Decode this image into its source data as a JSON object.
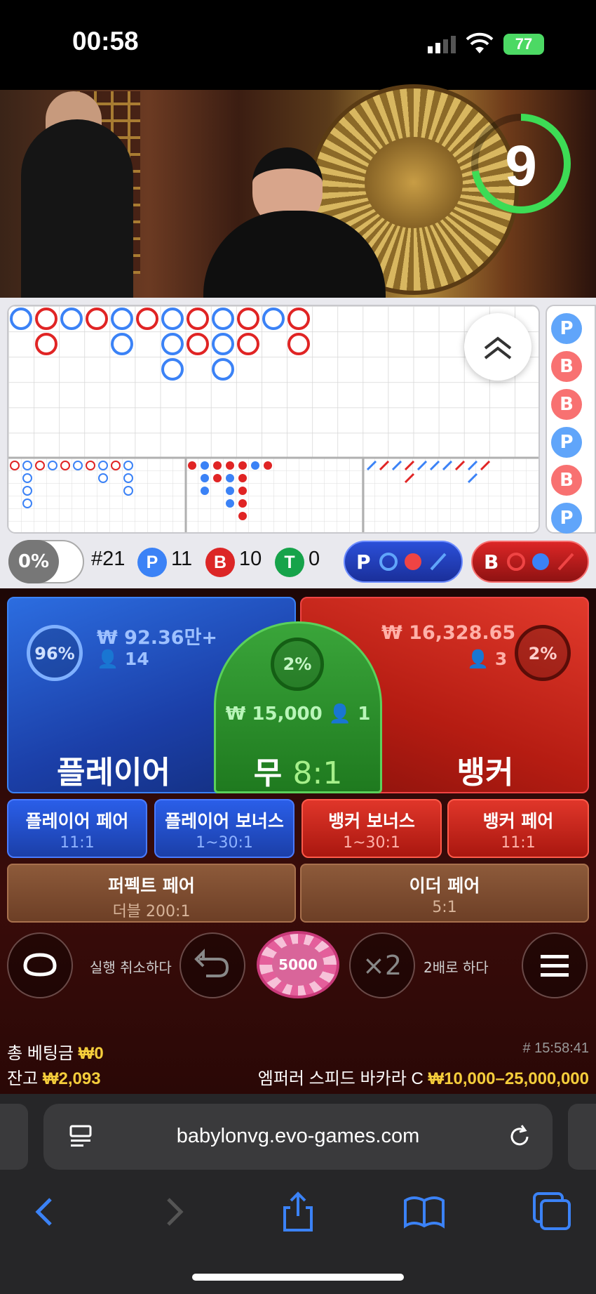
{
  "status_bar": {
    "time": "00:58",
    "battery": "77"
  },
  "video": {
    "countdown": "9"
  },
  "roadmap": {
    "side_results": [
      "P",
      "B",
      "B",
      "P",
      "B",
      "P"
    ]
  },
  "stats": {
    "toggle_pct": "0%",
    "round": "#21",
    "player_label": "P",
    "player_count": "11",
    "banker_label": "B",
    "banker_count": "10",
    "tie_label": "T",
    "tie_count": "0",
    "player_predict_label": "P",
    "banker_predict_label": "B"
  },
  "bets": {
    "player": {
      "label": "플레이어",
      "pct": "96%",
      "amount": "₩ 92.36만+",
      "players": "14"
    },
    "tie": {
      "label": "무",
      "odds": "8:1",
      "pct": "2%",
      "amount": "₩ 15,000",
      "players": "1"
    },
    "banker": {
      "label": "뱅커",
      "pct": "2%",
      "amount": "₩ 16,328.65",
      "players": "3"
    }
  },
  "side_bets": [
    {
      "label": "플레이어 페어",
      "odds": "11:1"
    },
    {
      "label": "플레이어 보너스",
      "odds": "1~30:1"
    },
    {
      "label": "뱅커 보너스",
      "odds": "1~30:1"
    },
    {
      "label": "뱅커 페어",
      "odds": "11:1"
    }
  ],
  "wide_bets": [
    {
      "label": "퍼펙트 페어",
      "odds": "더블 200:1"
    },
    {
      "label": "이더 페어",
      "odds": "5:1"
    }
  ],
  "controls": {
    "undo_label": "실행 취소하다",
    "chip_value": "5000",
    "double_icon": "×2",
    "double_label": "2배로 하다"
  },
  "footer": {
    "total_bet_label": "총 베팅금",
    "total_bet_value": "₩0",
    "balance_label": "잔고",
    "balance_value": "₩2,093",
    "round_time": "# 15:58:41",
    "table_name": "엠퍼러 스피드 바카라 C",
    "limits": "₩10,000–25,000,000"
  },
  "browser": {
    "url": "babylonvg.evo-games.com"
  },
  "colors": {
    "player": "#2563eb",
    "banker": "#dc2626",
    "tie": "#16a34a",
    "gold": "#f5cd3b"
  }
}
